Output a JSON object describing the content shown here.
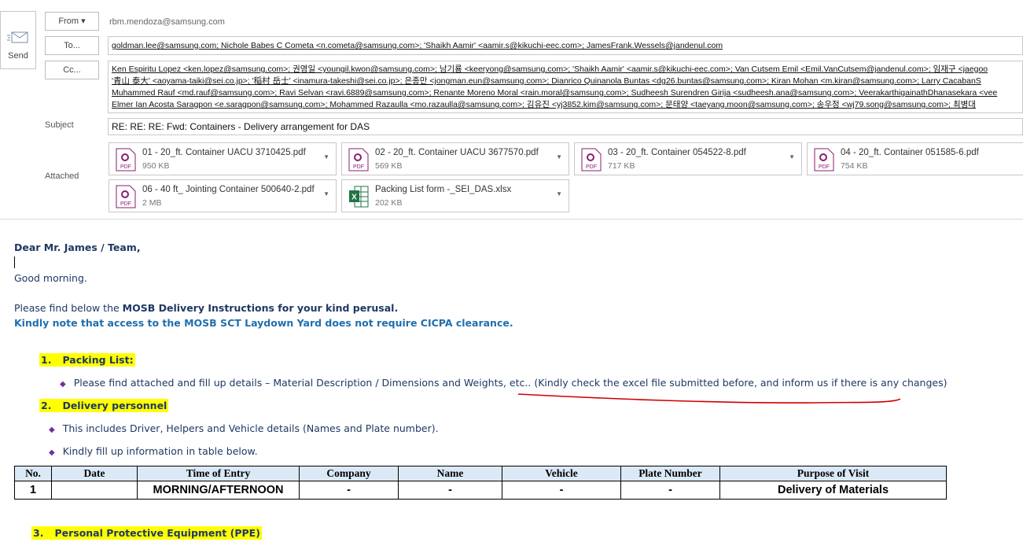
{
  "send": {
    "label": "Send"
  },
  "header": {
    "from_label": "From ▾",
    "from_value": "rbm.mendoza@samsung.com",
    "to_label": "To...",
    "cc_label": "Cc...",
    "subject_label": "Subject",
    "attached_label": "Attached",
    "to_recipients": "goldman.lee@samsung.com; Nichole Babes C Cometa <n.cometa@samsung.com>; 'Shaikh Aamir' <aamir.s@kikuchi-eec.com>; JamesFrank.Wessels@jandenul.com",
    "cc_lines": [
      "Ken Espiritu Lopez <ken.lopez@samsung.com>; 권영일 <youngil.kwon@samsung.com>; 남기룡 <keeryong@samsung.com>; 'Shaikh Aamir' <aamir.s@kikuchi-eec.com>; Van Cutsem Emil <Emil.VanCutsem@jandenul.com>; 임재구 <jaegoo",
      "'青山 泰大' <aoyama-taiki@sei.co.jp>; '稲村 岳士' <inamura-takeshi@sei.co.jp>; 은종만 <jongman.eun@samsung.com>; Dianrico Quinanola Buntas <dg26.buntas@samsung.com>; Kiran Mohan <m.kiran@samsung.com>; Larry CacabanS",
      "Muhammed Rauf <md.rauf@samsung.com>; Ravi Selvan <ravi.6889@samsung.com>; Renante Moreno Moral <rain.moral@samsung.com>; Sudheesh Surendren Girija <sudheesh.ana@samsung.com>; VeerakarthigainathDhanasekara <vee",
      "Elmer Ian Acosta Saragpon <e.saragpon@samsung.com>; Mohammed Razaulla <mo.razaulla@samsung.com>; 김유진 <yj3852.kim@samsung.com>; 문태양 <taeyang.moon@samsung.com>; 송우정 <wj79.song@samsung.com>; 최병대"
    ],
    "subject_value": "RE: RE: RE: Fwd: Containers - Delivery arrangement for DAS"
  },
  "attachments": [
    {
      "name": "01 - 20_ft. Container UACU 3710425.pdf",
      "size": "950 KB",
      "icon": "pdf-icon"
    },
    {
      "name": "02 - 20_ft. Container UACU 3677570.pdf",
      "size": "569 KB",
      "icon": "pdf-icon"
    },
    {
      "name": "03 - 20_ft. Container 054522-8.pdf",
      "size": "717 KB",
      "icon": "pdf-icon"
    },
    {
      "name": "04 - 20_ft. Container 051585-6.pdf",
      "size": "754 KB",
      "icon": "pdf-icon"
    },
    {
      "name": "06 - 40 ft_ Jointing Container 500640-2.pdf",
      "size": "2 MB",
      "icon": "pdf-icon"
    },
    {
      "name": "Packing List form -_SEI_DAS.xlsx",
      "size": "202 KB",
      "icon": "excel-icon"
    }
  ],
  "body": {
    "greeting": "Dear Mr. James / Team,",
    "good_morning": "Good morning.",
    "intro_prefix": "Please find below the ",
    "intro_bold": "MOSB Delivery Instructions for your kind perusal.",
    "note": "Kindly note that access to the MOSB SCT Laydown Yard does not require CICPA clearance.",
    "item1_num": "1.",
    "item1_title": "Packing List:",
    "item1_bullet": "Please find attached and fill up details – Material Description / Dimensions and Weights, etc..",
    "item1_note": " (Kindly check the excel file submitted before, and inform us if there is any changes)",
    "item2_num": "2.",
    "item2_title": "Delivery personnel",
    "item2_bullet1": "This includes Driver, Helpers and Vehicle details (Names and Plate number).",
    "item2_bullet2": "Kindly fill up information in table below.",
    "item3_num": "3.",
    "item3_title": "Personal Protective Equipment (PPE)"
  },
  "table": {
    "headers": [
      "No.",
      "Date",
      "Time of Entry",
      "Company",
      "Name",
      "Vehicle",
      "Plate Number",
      "Purpose of Visit"
    ],
    "row": [
      "1",
      "",
      "MORNING/AFTERNOON",
      "-",
      "-",
      "-",
      "-",
      "Delivery of Materials"
    ]
  },
  "colors": {
    "highlight": "#ffff00",
    "body_text": "#1f3864",
    "note_blue": "#1f6fae",
    "annotation_red": "#d00000"
  }
}
